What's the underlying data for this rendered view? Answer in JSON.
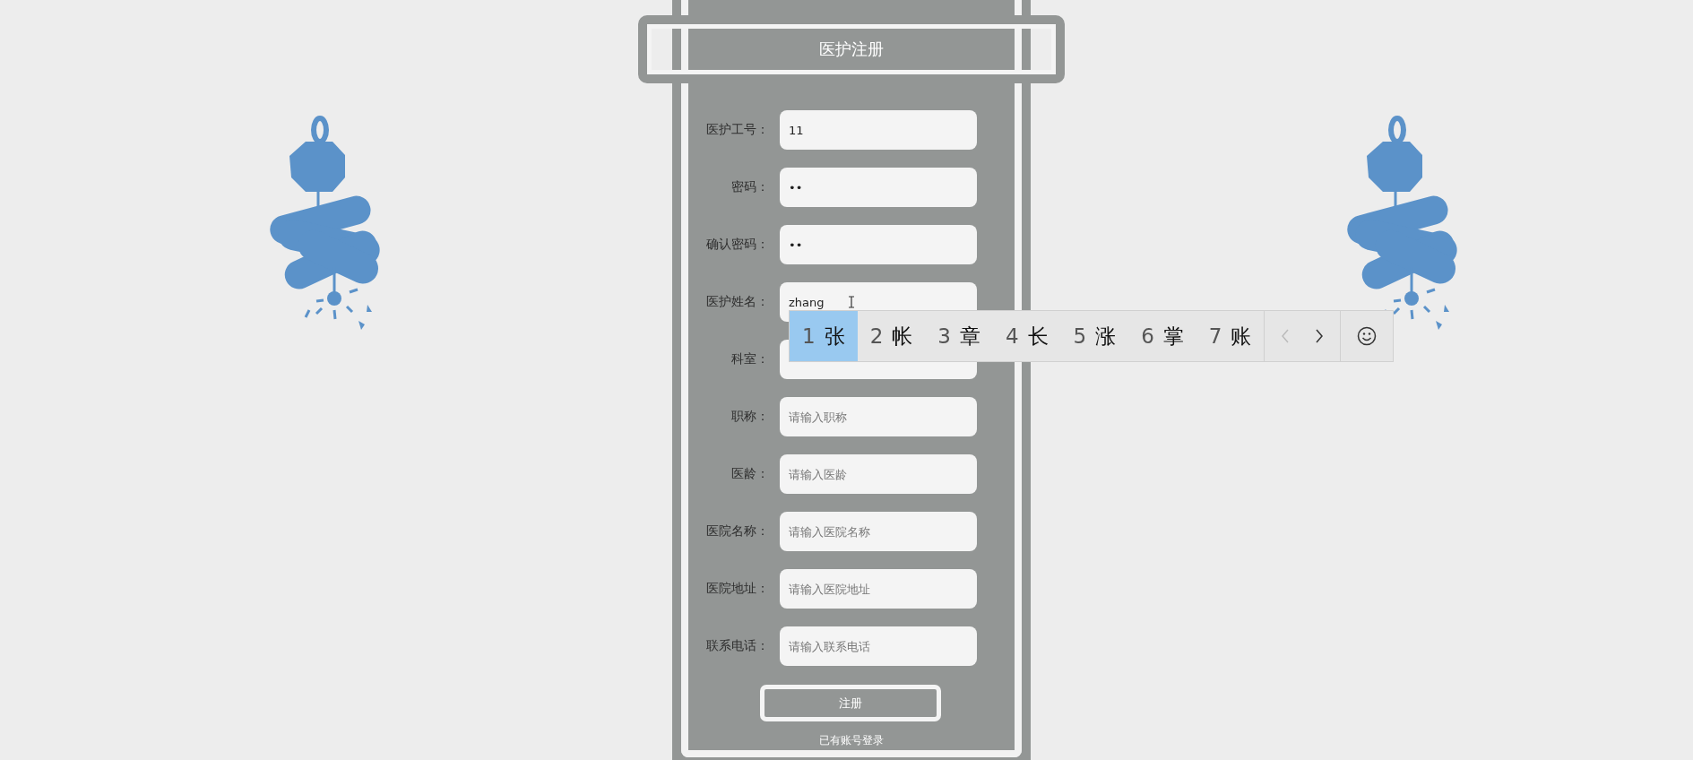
{
  "form": {
    "title": "医护注册",
    "fields": [
      {
        "label": "医护工号：",
        "kind": "text",
        "value": "11"
      },
      {
        "label": "密码：",
        "kind": "text",
        "value": "••"
      },
      {
        "label": "确认密码：",
        "kind": "text",
        "value": "••"
      },
      {
        "label": "医护姓名：",
        "kind": "text",
        "value": "zhang"
      },
      {
        "label": "科室：",
        "kind": "text"
      },
      {
        "label": "职称：",
        "kind": "text",
        "placeholder": "请输入职称"
      },
      {
        "label": "医龄：",
        "kind": "text",
        "placeholder": "请输入医龄"
      },
      {
        "label": "医院名称：",
        "kind": "text",
        "placeholder": "请输入医院名称"
      },
      {
        "label": "医院地址：",
        "kind": "text",
        "placeholder": "请输入医院地址"
      },
      {
        "label": "联系电话：",
        "kind": "text",
        "placeholder": "请输入联系电话"
      }
    ],
    "submit": "注册",
    "login_link": "已有账号登录"
  },
  "ime": {
    "candidates": [
      {
        "number": "1",
        "text": "张",
        "selected": true
      },
      {
        "number": "2",
        "text": "帐",
        "selected": false
      },
      {
        "number": "3",
        "text": "章",
        "selected": false
      },
      {
        "number": "4",
        "text": "长",
        "selected": false
      },
      {
        "number": "5",
        "text": "涨",
        "selected": false
      },
      {
        "number": "6",
        "text": "掌",
        "selected": false
      },
      {
        "number": "7",
        "text": "账",
        "selected": false
      }
    ]
  }
}
